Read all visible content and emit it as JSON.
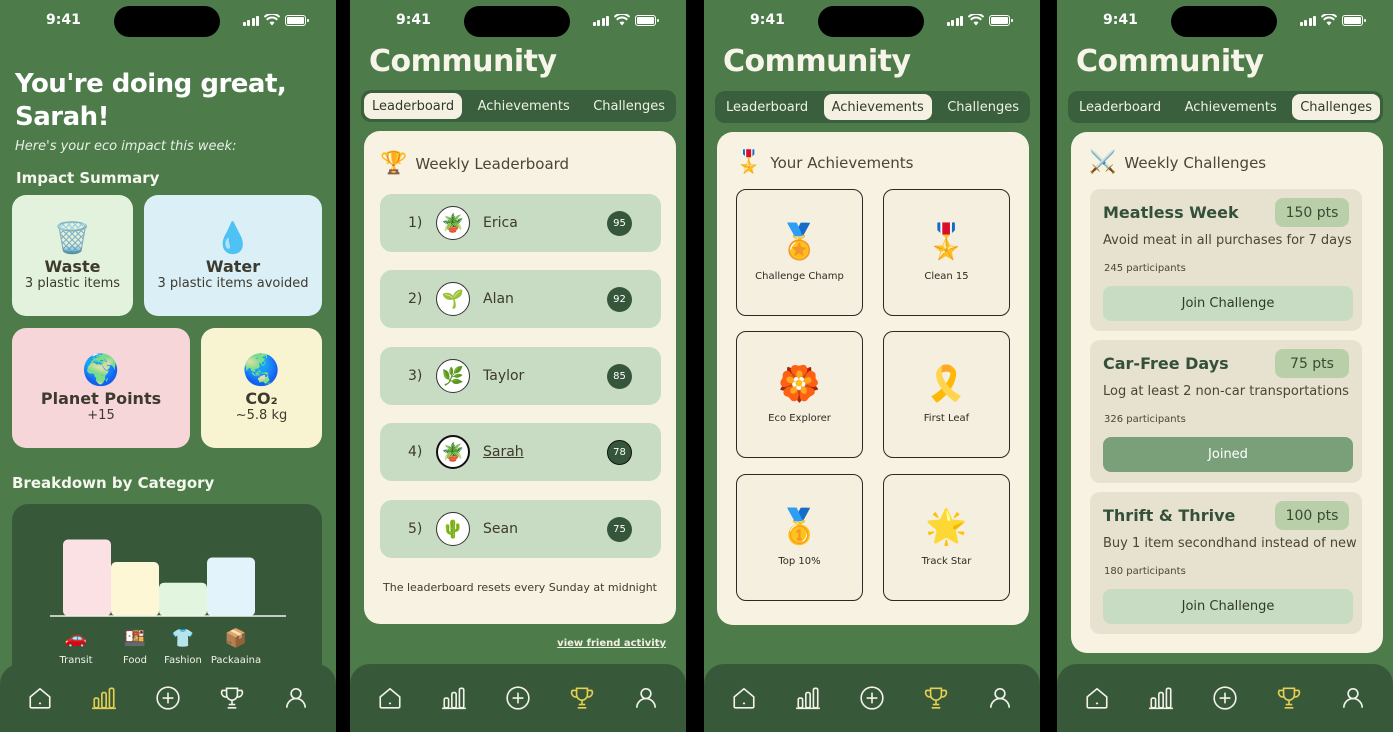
{
  "status": {
    "time": "9:41"
  },
  "home": {
    "greeting": "You're doing great, Sarah!",
    "subtitle": "Here's your eco impact this week:",
    "impact_title": "Impact Summary",
    "cards": [
      {
        "title": "Waste",
        "value": "3 plastic items",
        "icon": "recycle-bin-icon",
        "glyph": "🗑️",
        "color": "#e2f2dc"
      },
      {
        "title": "Water",
        "value": "3 plastic items avoided",
        "icon": "water-drop-icon",
        "glyph": "💧",
        "color": "#dbeff7"
      },
      {
        "title": "Planet Points",
        "value": "+15",
        "icon": "planet-icon",
        "glyph": "🌍",
        "color": "#f7d6da"
      },
      {
        "title": "CO₂",
        "value": "~5.8 kg",
        "icon": "earth-icon",
        "glyph": "🌏",
        "color": "#f8f4d2"
      }
    ],
    "breakdown_title": "Breakdown by Category",
    "chart_data": {
      "type": "bar",
      "categories": [
        "Transit",
        "Food",
        "Fashion",
        "Packaaina"
      ],
      "values": [
        85,
        60,
        37,
        65
      ],
      "colors": [
        "#fce1e4",
        "#fdf7d6",
        "#e2f6df",
        "#e2f3fb"
      ],
      "icons": [
        "🚗",
        "🍱",
        "👕",
        "📦"
      ]
    }
  },
  "community": {
    "title": "Community",
    "tabs": [
      "Leaderboard",
      "Achievements",
      "Challenges"
    ],
    "leaderboard": {
      "title": "Weekly Leaderboard",
      "rows": [
        {
          "rank": "1)",
          "name": "Erica",
          "score": "95",
          "avatar": "🪴"
        },
        {
          "rank": "2)",
          "name": "Alan",
          "score": "92",
          "avatar": "🌱"
        },
        {
          "rank": "3)",
          "name": "Taylor",
          "score": "85",
          "avatar": "🌿"
        },
        {
          "rank": "4)",
          "name": "Sarah",
          "score": "78",
          "avatar": "🪴"
        },
        {
          "rank": "5)",
          "name": "Sean",
          "score": "75",
          "avatar": "🌵"
        }
      ],
      "footer": "The leaderboard resets every Sunday at midnight",
      "link": "view friend activity"
    },
    "achievements": {
      "title": "Your Achievements",
      "items": [
        {
          "label": "Challenge Champ",
          "medal": "🏅"
        },
        {
          "label": "Clean 15",
          "medal": "🎖️"
        },
        {
          "label": "Eco Explorer",
          "medal": "🏵️"
        },
        {
          "label": "First Leaf",
          "medal": "🎗️"
        },
        {
          "label": "Top 10%",
          "medal": "🥇"
        },
        {
          "label": "Track Star",
          "medal": "🌟"
        }
      ]
    },
    "challenges": {
      "title": "Weekly Challenges",
      "items": [
        {
          "title": "Meatless Week",
          "points": "150 pts",
          "desc": "Avoid meat in all purchases for 7 days",
          "participants": "245 participants",
          "button": "Join Challenge",
          "joined": false
        },
        {
          "title": "Car-Free Days",
          "points": "75 pts",
          "desc": "Log at least 2 non-car transportations",
          "participants": "326 participants",
          "button": "Joined",
          "joined": true
        },
        {
          "title": "Thrift & Thrive",
          "points": "100 pts",
          "desc": "Buy 1 item secondhand instead of new",
          "participants": "180 participants",
          "button": "Join Challenge",
          "joined": false
        }
      ]
    }
  },
  "colors": {
    "active_tab": "#e6cf52",
    "inactive_tab": "#f2f2ea"
  }
}
